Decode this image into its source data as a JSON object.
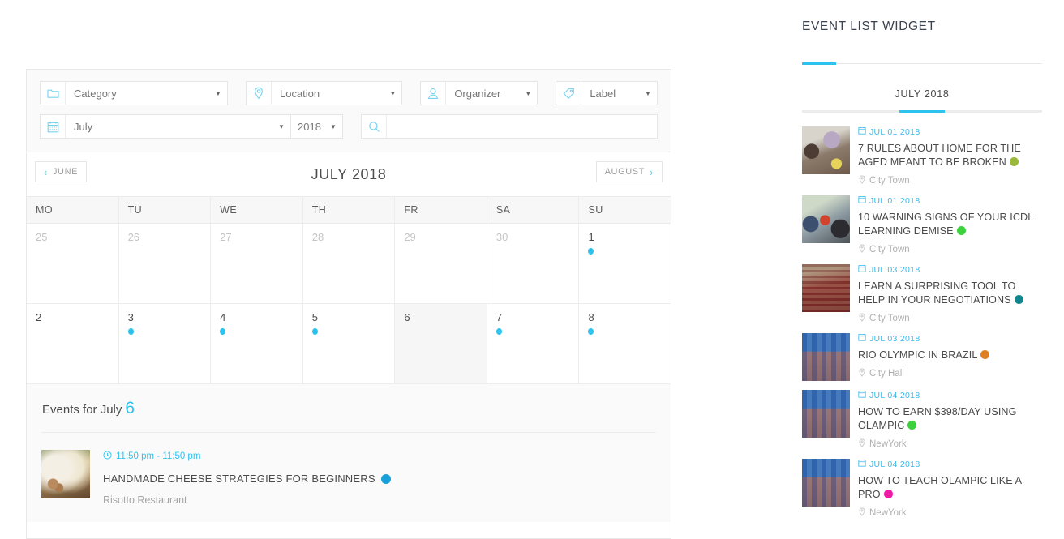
{
  "filters": {
    "category": {
      "icon": "folder-icon",
      "value": "Category"
    },
    "location": {
      "icon": "map-pin-icon",
      "value": "Location"
    },
    "organizer": {
      "icon": "user-icon",
      "value": "Organizer"
    },
    "label": {
      "icon": "tag-icon",
      "value": "Label"
    },
    "month": {
      "icon": "calendar-icon",
      "value": "July"
    },
    "year": {
      "value": "2018"
    },
    "search": {
      "icon": "search-icon",
      "value": "",
      "placeholder": ""
    }
  },
  "calendar": {
    "prev_label": "JUNE",
    "next_label": "AUGUST",
    "title": "JULY 2018",
    "weekdays": [
      "MO",
      "TU",
      "WE",
      "TH",
      "FR",
      "SA",
      "SU"
    ],
    "weeks": [
      [
        {
          "num": "25",
          "muted": true,
          "dot": false,
          "selected": false
        },
        {
          "num": "26",
          "muted": true,
          "dot": false,
          "selected": false
        },
        {
          "num": "27",
          "muted": true,
          "dot": false,
          "selected": false
        },
        {
          "num": "28",
          "muted": true,
          "dot": false,
          "selected": false
        },
        {
          "num": "29",
          "muted": true,
          "dot": false,
          "selected": false
        },
        {
          "num": "30",
          "muted": true,
          "dot": false,
          "selected": false
        },
        {
          "num": "1",
          "muted": false,
          "dot": true,
          "selected": false
        }
      ],
      [
        {
          "num": "2",
          "muted": false,
          "dot": false,
          "selected": false
        },
        {
          "num": "3",
          "muted": false,
          "dot": true,
          "selected": false
        },
        {
          "num": "4",
          "muted": false,
          "dot": true,
          "selected": false
        },
        {
          "num": "5",
          "muted": false,
          "dot": true,
          "selected": false
        },
        {
          "num": "6",
          "muted": false,
          "dot": false,
          "selected": true
        },
        {
          "num": "7",
          "muted": false,
          "dot": true,
          "selected": false
        },
        {
          "num": "8",
          "muted": false,
          "dot": true,
          "selected": false
        }
      ]
    ]
  },
  "day_events": {
    "heading_prefix": "Events for July",
    "heading_day": "6",
    "items": [
      {
        "time": "11:50 pm - 11:50 pm",
        "title": "HANDMADE CHEESE STRATEGIES FOR BEGINNERS",
        "location": "Risotto Restaurant",
        "dot_color": "#1b9fd8",
        "time_icon": "clock-icon"
      }
    ]
  },
  "widget": {
    "title": "EVENT LIST WIDGET",
    "tab_label": "JULY 2018",
    "accent": "#2ec3ef",
    "events": [
      {
        "date": "JUL 01 2018",
        "title": "7 RULES ABOUT HOME FOR THE AGED MEANT TO BE BROKEN",
        "location": "City Town",
        "dot_color": "#9ab83a",
        "thumb": "t1"
      },
      {
        "date": "JUL 01 2018",
        "title": "10 WARNING SIGNS OF YOUR ICDL LEARNING DEMISE",
        "location": "City Town",
        "dot_color": "#3dd13d",
        "thumb": "t2"
      },
      {
        "date": "JUL 03 2018",
        "title": "LEARN A SURPRISING TOOL TO HELP IN YOUR NEGOTIATIONS",
        "location": "City Town",
        "dot_color": "#11868f",
        "thumb": "t3"
      },
      {
        "date": "JUL 03 2018",
        "title": "RIO OLYMPIC IN BRAZIL",
        "location": "City Hall",
        "dot_color": "#e08020",
        "thumb": "t4"
      },
      {
        "date": "JUL 04 2018",
        "title": "HOW TO EARN $398/DAY USING OLAMPIC",
        "location": "NewYork",
        "dot_color": "#3dd13d",
        "thumb": "t4"
      },
      {
        "date": "JUL 04 2018",
        "title": "HOW TO TEACH OLAMPIC LIKE A PRO",
        "location": "NewYork",
        "dot_color": "#f01ba5",
        "thumb": "t4"
      }
    ]
  }
}
